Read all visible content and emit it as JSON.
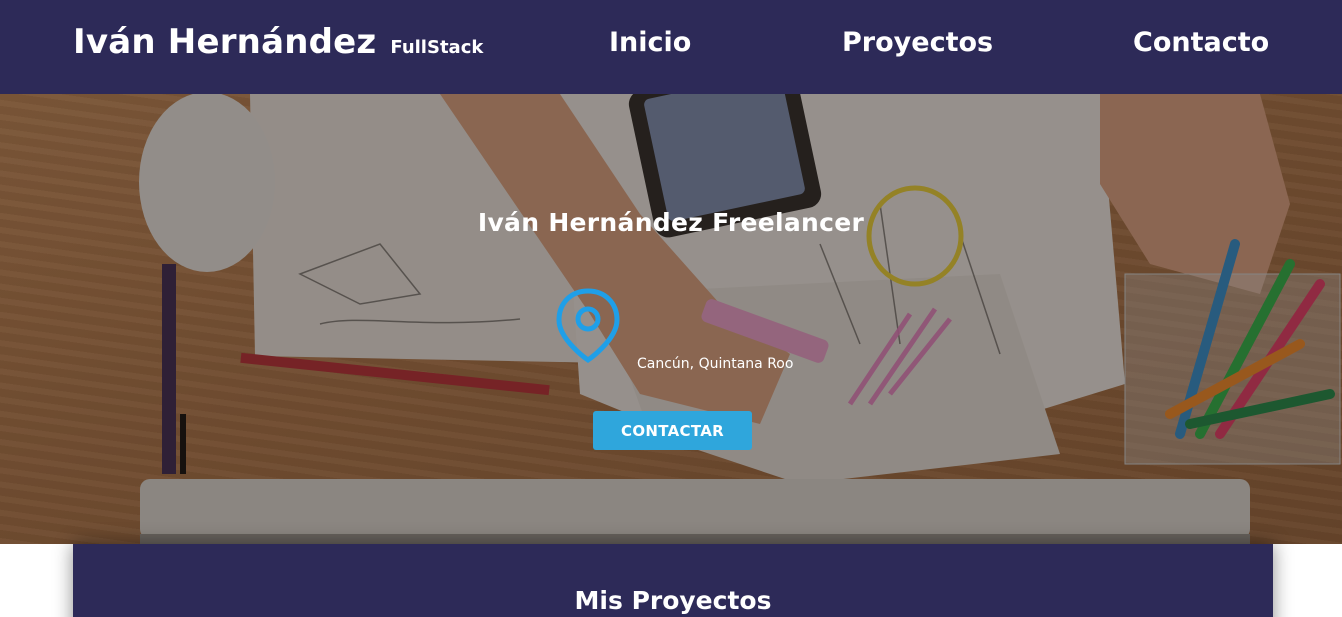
{
  "header": {
    "brand_name": "Iván Hernández",
    "brand_tag": "FullStack",
    "nav": {
      "inicio": "Inicio",
      "proyectos": "Proyectos",
      "contacto": "Contacto"
    }
  },
  "hero": {
    "title": "Iván Hernández Freelancer",
    "location": "Cancún, Quintana Roo",
    "button_label": "CONTACTAR",
    "location_icon": "map-pin-icon"
  },
  "projects": {
    "title": "Mis Proyectos"
  },
  "colors": {
    "header_bg": "#2d2a58",
    "accent": "#2fa6dc",
    "text": "#ffffff"
  }
}
